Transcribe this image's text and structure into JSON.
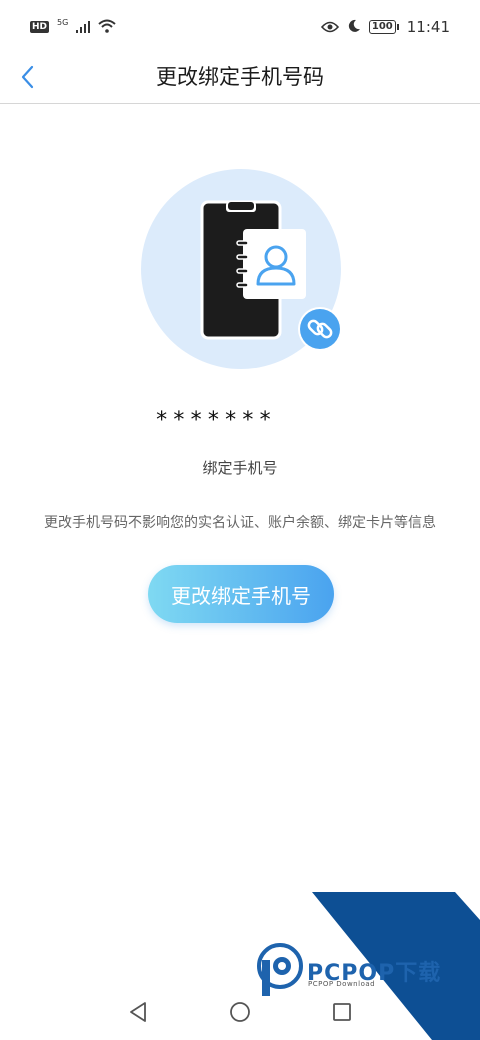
{
  "status_bar": {
    "hd_badge": "HD",
    "network": "5G",
    "battery": "100",
    "time": "11:41"
  },
  "header": {
    "title": "更改绑定手机号码",
    "back_icon": "chevron-left-icon"
  },
  "content": {
    "masked_number": "*******",
    "number_label": "绑定手机号",
    "notice": "更改手机号码不影响您的实名认证、账户余额、绑定卡片等信息",
    "button_label": "更改绑定手机号"
  },
  "watermark": {
    "brand": "PCPOP下载",
    "sub": "PCPOP Download"
  },
  "nav_bar": {
    "back": "back-triangle-icon",
    "home": "home-circle-icon",
    "recents": "recents-square-icon"
  },
  "colors": {
    "accent": "#4aa3ef",
    "accent_light": "#7fd9f2",
    "circle_bg": "#dcebfb",
    "phone_body": "#1c1c1c",
    "watermark_blue": "#0d4f94"
  }
}
